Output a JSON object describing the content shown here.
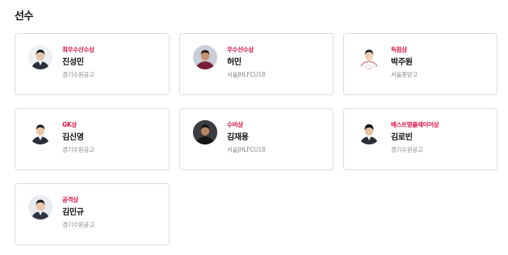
{
  "section": {
    "title": "선수"
  },
  "colors": {
    "award": "#d8103f",
    "border": "#dcdcdc",
    "team": "#8a8a8a"
  },
  "players": [
    {
      "award": "최우수선수상",
      "name": "진성민",
      "team": "경기수원공고",
      "avatar_icon": "player-photo-icon"
    },
    {
      "award": "우수선수상",
      "name": "허민",
      "team": "서울JHLFCU18",
      "avatar_icon": "player-photo-icon"
    },
    {
      "award": "득점상",
      "name": "박주원",
      "team": "서울중앙고",
      "avatar_icon": "player-photo-icon"
    },
    {
      "award": "GK상",
      "name": "김신영",
      "team": "경기수원공고",
      "avatar_icon": "player-photo-icon"
    },
    {
      "award": "수비상",
      "name": "김재용",
      "team": "서울JHLFCU18",
      "avatar_icon": "player-photo-icon"
    },
    {
      "award": "베스트영플레이어상",
      "name": "김로빈",
      "team": "경기수원공고",
      "avatar_icon": "player-photo-icon"
    },
    {
      "award": "공격상",
      "name": "김민규",
      "team": "경기수원공고",
      "avatar_icon": "player-photo-icon"
    }
  ]
}
